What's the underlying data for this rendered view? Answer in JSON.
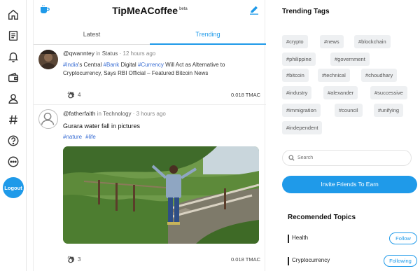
{
  "app": {
    "title": "TipMeACoffee",
    "badge": "beta"
  },
  "sidebar": {
    "icons": [
      "home-icon",
      "document-icon",
      "bell-icon",
      "wallet-icon",
      "user-icon",
      "hashtag-icon",
      "help-icon",
      "more-icon"
    ],
    "logout_label": "Logout"
  },
  "tabs": {
    "latest": "Latest",
    "trending": "Trending",
    "active": "trending"
  },
  "posts": [
    {
      "username": "@qwanntey",
      "in": "in",
      "category": "Status",
      "time": "· 12 hours ago",
      "text_parts": [
        {
          "t": "#India",
          "tag": true
        },
        {
          "t": "'s Central ",
          "tag": false
        },
        {
          "t": "#Bank",
          "tag": true
        },
        {
          "t": " Digital ",
          "tag": false
        },
        {
          "t": "#Currency",
          "tag": true
        },
        {
          "t": " Will Act as Alternative to Cryptocurrency, Says RBI Official – Featured Bitcoin News",
          "tag": false
        }
      ],
      "likes": "4",
      "amount": "0.018 TMAC"
    },
    {
      "username": "@fatherfaith",
      "in": "in",
      "category": "Technology",
      "time": "· 3 hours ago",
      "title": "Gurara water fall in pictures",
      "tags": [
        "#nature",
        "#life"
      ],
      "likes": "3",
      "amount": "0.018 TMAC"
    }
  ],
  "trending": {
    "title": "Trending Tags",
    "tags": [
      "#crypto",
      "#news",
      "#blockchain",
      "#philippine",
      "#government",
      "#bitcoin",
      "#technical",
      "#choudhary",
      "#industry",
      "#alexander",
      "#successive",
      "#immigration",
      "#council",
      "#unifying",
      "#independent"
    ]
  },
  "search": {
    "placeholder": "Search",
    "value": ""
  },
  "invite_label": "Invite Friends To Earn",
  "recommended": {
    "title": "Recomended Topics",
    "topics": [
      {
        "name": "Health",
        "action": "Follow"
      },
      {
        "name": "Cryptocurrency",
        "action": "Following"
      }
    ]
  },
  "colors": {
    "accent": "#1f9ae9",
    "tag_link": "#3b6fd4",
    "chip_bg": "#eef0f2"
  }
}
